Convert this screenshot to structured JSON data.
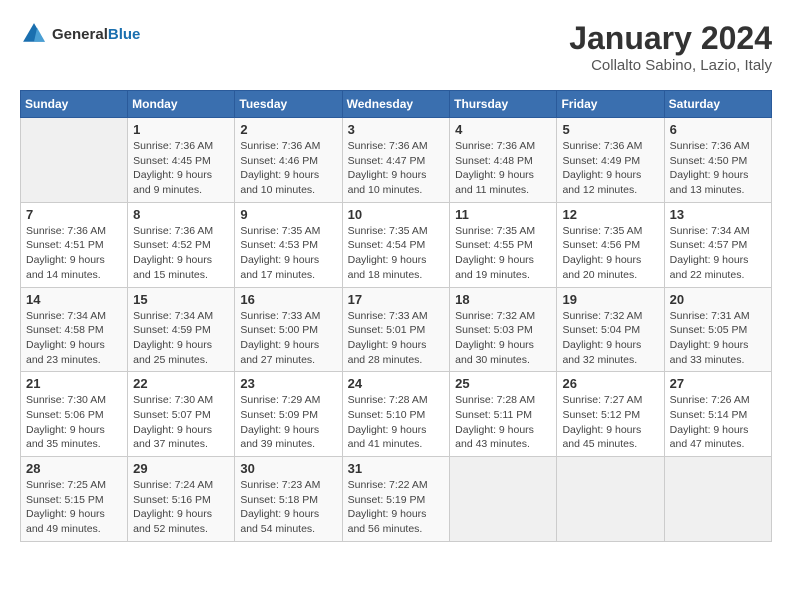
{
  "header": {
    "logo_general": "General",
    "logo_blue": "Blue",
    "month_title": "January 2024",
    "subtitle": "Collalto Sabino, Lazio, Italy"
  },
  "columns": [
    "Sunday",
    "Monday",
    "Tuesday",
    "Wednesday",
    "Thursday",
    "Friday",
    "Saturday"
  ],
  "weeks": [
    [
      {
        "day": "",
        "sunrise": "",
        "sunset": "",
        "daylight": ""
      },
      {
        "day": "1",
        "sunrise": "Sunrise: 7:36 AM",
        "sunset": "Sunset: 4:45 PM",
        "daylight": "Daylight: 9 hours and 9 minutes."
      },
      {
        "day": "2",
        "sunrise": "Sunrise: 7:36 AM",
        "sunset": "Sunset: 4:46 PM",
        "daylight": "Daylight: 9 hours and 10 minutes."
      },
      {
        "day": "3",
        "sunrise": "Sunrise: 7:36 AM",
        "sunset": "Sunset: 4:47 PM",
        "daylight": "Daylight: 9 hours and 10 minutes."
      },
      {
        "day": "4",
        "sunrise": "Sunrise: 7:36 AM",
        "sunset": "Sunset: 4:48 PM",
        "daylight": "Daylight: 9 hours and 11 minutes."
      },
      {
        "day": "5",
        "sunrise": "Sunrise: 7:36 AM",
        "sunset": "Sunset: 4:49 PM",
        "daylight": "Daylight: 9 hours and 12 minutes."
      },
      {
        "day": "6",
        "sunrise": "Sunrise: 7:36 AM",
        "sunset": "Sunset: 4:50 PM",
        "daylight": "Daylight: 9 hours and 13 minutes."
      }
    ],
    [
      {
        "day": "7",
        "sunrise": "Sunrise: 7:36 AM",
        "sunset": "Sunset: 4:51 PM",
        "daylight": "Daylight: 9 hours and 14 minutes."
      },
      {
        "day": "8",
        "sunrise": "Sunrise: 7:36 AM",
        "sunset": "Sunset: 4:52 PM",
        "daylight": "Daylight: 9 hours and 15 minutes."
      },
      {
        "day": "9",
        "sunrise": "Sunrise: 7:35 AM",
        "sunset": "Sunset: 4:53 PM",
        "daylight": "Daylight: 9 hours and 17 minutes."
      },
      {
        "day": "10",
        "sunrise": "Sunrise: 7:35 AM",
        "sunset": "Sunset: 4:54 PM",
        "daylight": "Daylight: 9 hours and 18 minutes."
      },
      {
        "day": "11",
        "sunrise": "Sunrise: 7:35 AM",
        "sunset": "Sunset: 4:55 PM",
        "daylight": "Daylight: 9 hours and 19 minutes."
      },
      {
        "day": "12",
        "sunrise": "Sunrise: 7:35 AM",
        "sunset": "Sunset: 4:56 PM",
        "daylight": "Daylight: 9 hours and 20 minutes."
      },
      {
        "day": "13",
        "sunrise": "Sunrise: 7:34 AM",
        "sunset": "Sunset: 4:57 PM",
        "daylight": "Daylight: 9 hours and 22 minutes."
      }
    ],
    [
      {
        "day": "14",
        "sunrise": "Sunrise: 7:34 AM",
        "sunset": "Sunset: 4:58 PM",
        "daylight": "Daylight: 9 hours and 23 minutes."
      },
      {
        "day": "15",
        "sunrise": "Sunrise: 7:34 AM",
        "sunset": "Sunset: 4:59 PM",
        "daylight": "Daylight: 9 hours and 25 minutes."
      },
      {
        "day": "16",
        "sunrise": "Sunrise: 7:33 AM",
        "sunset": "Sunset: 5:00 PM",
        "daylight": "Daylight: 9 hours and 27 minutes."
      },
      {
        "day": "17",
        "sunrise": "Sunrise: 7:33 AM",
        "sunset": "Sunset: 5:01 PM",
        "daylight": "Daylight: 9 hours and 28 minutes."
      },
      {
        "day": "18",
        "sunrise": "Sunrise: 7:32 AM",
        "sunset": "Sunset: 5:03 PM",
        "daylight": "Daylight: 9 hours and 30 minutes."
      },
      {
        "day": "19",
        "sunrise": "Sunrise: 7:32 AM",
        "sunset": "Sunset: 5:04 PM",
        "daylight": "Daylight: 9 hours and 32 minutes."
      },
      {
        "day": "20",
        "sunrise": "Sunrise: 7:31 AM",
        "sunset": "Sunset: 5:05 PM",
        "daylight": "Daylight: 9 hours and 33 minutes."
      }
    ],
    [
      {
        "day": "21",
        "sunrise": "Sunrise: 7:30 AM",
        "sunset": "Sunset: 5:06 PM",
        "daylight": "Daylight: 9 hours and 35 minutes."
      },
      {
        "day": "22",
        "sunrise": "Sunrise: 7:30 AM",
        "sunset": "Sunset: 5:07 PM",
        "daylight": "Daylight: 9 hours and 37 minutes."
      },
      {
        "day": "23",
        "sunrise": "Sunrise: 7:29 AM",
        "sunset": "Sunset: 5:09 PM",
        "daylight": "Daylight: 9 hours and 39 minutes."
      },
      {
        "day": "24",
        "sunrise": "Sunrise: 7:28 AM",
        "sunset": "Sunset: 5:10 PM",
        "daylight": "Daylight: 9 hours and 41 minutes."
      },
      {
        "day": "25",
        "sunrise": "Sunrise: 7:28 AM",
        "sunset": "Sunset: 5:11 PM",
        "daylight": "Daylight: 9 hours and 43 minutes."
      },
      {
        "day": "26",
        "sunrise": "Sunrise: 7:27 AM",
        "sunset": "Sunset: 5:12 PM",
        "daylight": "Daylight: 9 hours and 45 minutes."
      },
      {
        "day": "27",
        "sunrise": "Sunrise: 7:26 AM",
        "sunset": "Sunset: 5:14 PM",
        "daylight": "Daylight: 9 hours and 47 minutes."
      }
    ],
    [
      {
        "day": "28",
        "sunrise": "Sunrise: 7:25 AM",
        "sunset": "Sunset: 5:15 PM",
        "daylight": "Daylight: 9 hours and 49 minutes."
      },
      {
        "day": "29",
        "sunrise": "Sunrise: 7:24 AM",
        "sunset": "Sunset: 5:16 PM",
        "daylight": "Daylight: 9 hours and 52 minutes."
      },
      {
        "day": "30",
        "sunrise": "Sunrise: 7:23 AM",
        "sunset": "Sunset: 5:18 PM",
        "daylight": "Daylight: 9 hours and 54 minutes."
      },
      {
        "day": "31",
        "sunrise": "Sunrise: 7:22 AM",
        "sunset": "Sunset: 5:19 PM",
        "daylight": "Daylight: 9 hours and 56 minutes."
      },
      {
        "day": "",
        "sunrise": "",
        "sunset": "",
        "daylight": ""
      },
      {
        "day": "",
        "sunrise": "",
        "sunset": "",
        "daylight": ""
      },
      {
        "day": "",
        "sunrise": "",
        "sunset": "",
        "daylight": ""
      }
    ]
  ]
}
